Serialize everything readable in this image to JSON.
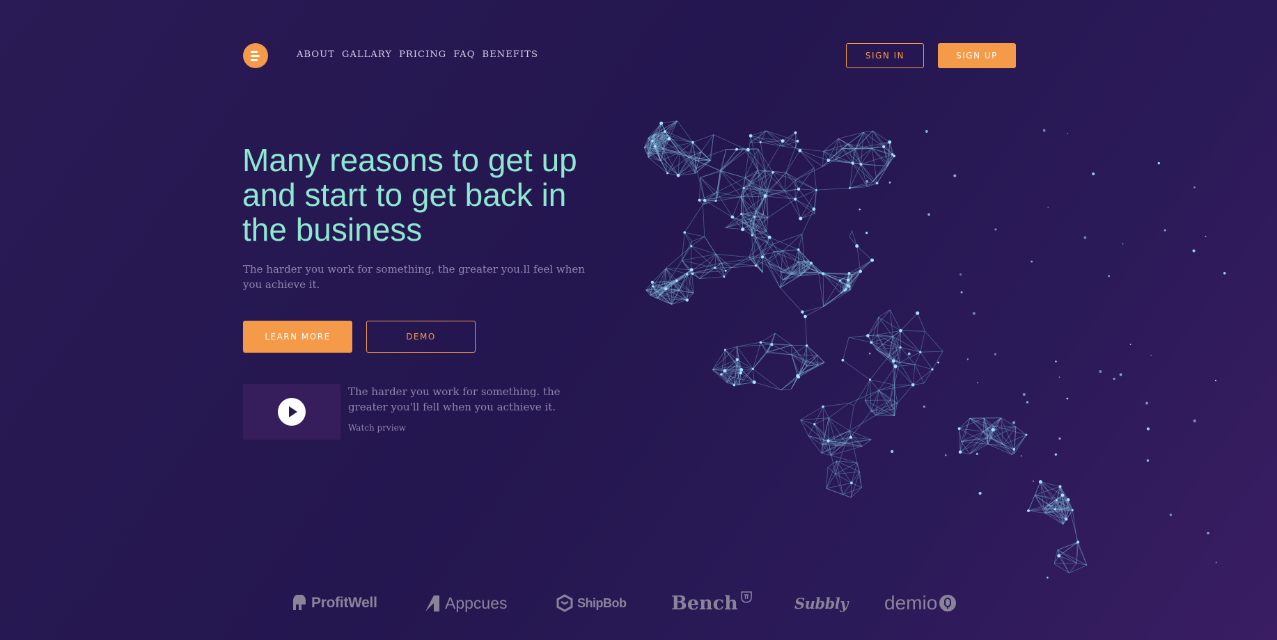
{
  "nav": {
    "menu": [
      "ABOUT",
      "GALLARY",
      "PRICING",
      "FAQ",
      "BENEFITS"
    ],
    "sign_in": "SIGN IN",
    "sign_up": "SIGN UP"
  },
  "hero": {
    "title": "Many reasons to get up and start to get back in the business",
    "subtitle": "The harder you work for something, the greater you.ll feel when you achieve it.",
    "learn_more": "LEARN MORE",
    "demo": "DEMO"
  },
  "video": {
    "text": "The harder you work for something. the greater you'll fell when you acthieve it.",
    "watch": "Watch prview"
  },
  "brands": [
    "ProfitWell",
    "Appcues",
    "ShipBob",
    "Bench",
    "Subbly",
    "demio"
  ],
  "colors": {
    "accent": "#f59a48",
    "title": "#8ee7d0",
    "background": "#24164f"
  }
}
